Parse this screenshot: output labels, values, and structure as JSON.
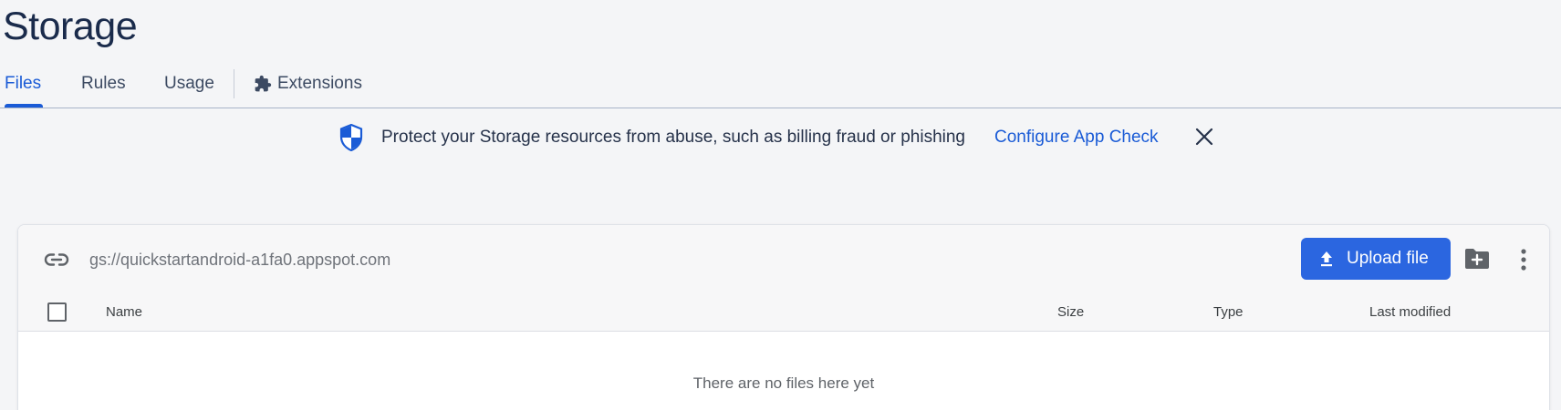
{
  "page": {
    "title": "Storage"
  },
  "tabs": [
    {
      "label": "Files",
      "active": true
    },
    {
      "label": "Rules",
      "active": false
    },
    {
      "label": "Usage",
      "active": false
    },
    {
      "label": "Extensions",
      "active": false,
      "icon": "puzzle-icon"
    }
  ],
  "banner": {
    "icon": "shield-icon",
    "text": "Protect your Storage resources from abuse, such as billing fraud or phishing",
    "link_label": "Configure App Check",
    "close_icon": "close-icon"
  },
  "files_panel": {
    "bucket_icon": "link-icon",
    "bucket_path": "gs://quickstartandroid-a1fa0.appspot.com",
    "upload_button_label": "Upload file",
    "upload_icon": "upload-icon",
    "new_folder_icon": "create-folder-icon",
    "more_icon": "more-vert-icon",
    "columns": [
      "Name",
      "Size",
      "Type",
      "Last modified"
    ],
    "empty_message": "There are no files here yet"
  },
  "colors": {
    "accent": "#1a5bd6",
    "primary_button": "#2b66e0",
    "title": "#1a2b4b",
    "background": "#f4f5f7"
  }
}
